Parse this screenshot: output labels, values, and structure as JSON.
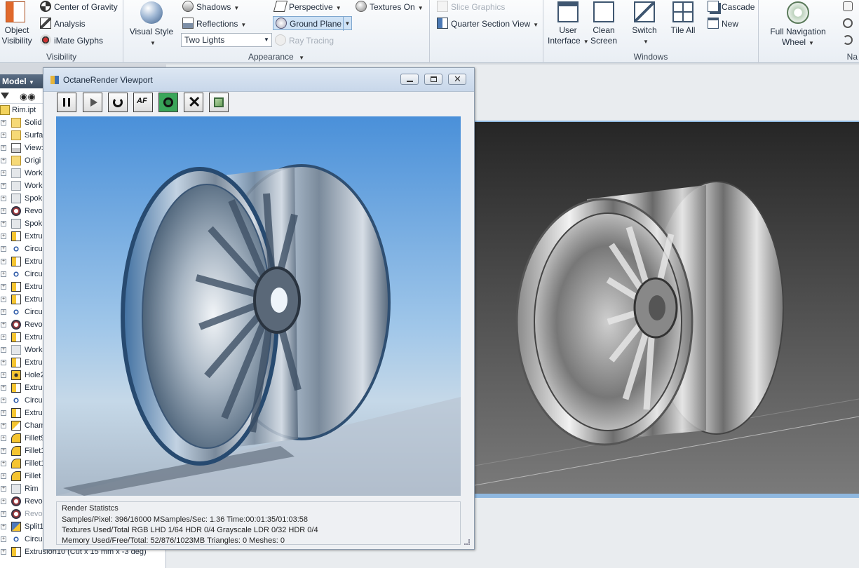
{
  "ribbon": {
    "visibility": {
      "object_visibility_label": "Object\nVisibility",
      "center_of_gravity": "Center of Gravity",
      "analysis": "Analysis",
      "imate_glyphs": "iMate Glyphs",
      "group_label": "Visibility"
    },
    "appearance": {
      "visual_style_label": "Visual Style",
      "shadows": "Shadows",
      "reflections": "Reflections",
      "lights_value": "Two Lights",
      "perspective": "Perspective",
      "ground_plane": "Ground Plane",
      "ray_tracing": "Ray Tracing",
      "textures_on": "Textures On",
      "group_label": "Appearance"
    },
    "section": {
      "slice_graphics": "Slice Graphics",
      "quarter_section_view": "Quarter Section View"
    },
    "windows": {
      "user_interface": "User\nInterface",
      "clean_screen": "Clean\nScreen",
      "switch": "Switch",
      "tile_all": "Tile All",
      "cascade": "Cascade",
      "new": "New",
      "group_label": "Windows"
    },
    "navigate": {
      "full_navigation_wheel": "Full Navigation\nWheel",
      "group_label_partial": "Na"
    }
  },
  "browser": {
    "header": "Model",
    "items": [
      {
        "label": "Rim.ipt",
        "icon": "part-icon",
        "root": true
      },
      {
        "label": "Solid",
        "icon": "folder-icon"
      },
      {
        "label": "Surfa",
        "icon": "folder-icon"
      },
      {
        "label": "View:",
        "icon": "view-icon"
      },
      {
        "label": "Origi",
        "icon": "folder-icon"
      },
      {
        "label": "Work",
        "icon": "workplane-icon"
      },
      {
        "label": "Work",
        "icon": "workplane-icon"
      },
      {
        "label": "Spok",
        "icon": "sketch-icon"
      },
      {
        "label": "Revo",
        "icon": "revolve-icon"
      },
      {
        "label": "Spok",
        "icon": "sketch-icon"
      },
      {
        "label": "Extru",
        "icon": "extrude-icon"
      },
      {
        "label": "Circu",
        "icon": "pattern-icon"
      },
      {
        "label": "Extru",
        "icon": "extrude-icon"
      },
      {
        "label": "Circu",
        "icon": "pattern-icon"
      },
      {
        "label": "Extru",
        "icon": "extrude-icon"
      },
      {
        "label": "Extru",
        "icon": "extrude-icon"
      },
      {
        "label": "Circu",
        "icon": "pattern-icon"
      },
      {
        "label": "Revo",
        "icon": "revolve-icon"
      },
      {
        "label": "Extru",
        "icon": "extrude-icon"
      },
      {
        "label": "Work",
        "icon": "workplane-icon"
      },
      {
        "label": "Extru",
        "icon": "extrude-icon"
      },
      {
        "label": "Hole2",
        "icon": "hole-icon"
      },
      {
        "label": "Extru",
        "icon": "extrude-icon"
      },
      {
        "label": "Circu",
        "icon": "pattern-icon"
      },
      {
        "label": "Extru",
        "icon": "extrude-icon"
      },
      {
        "label": "Cham",
        "icon": "chamfer-icon"
      },
      {
        "label": "Fillet9",
        "icon": "fillet-icon"
      },
      {
        "label": "Fillet1",
        "icon": "fillet-icon"
      },
      {
        "label": "Fillet1",
        "icon": "fillet-icon"
      },
      {
        "label": "Fillet",
        "icon": "fillet-icon"
      },
      {
        "label": "Rim",
        "icon": "sketch-icon"
      },
      {
        "label": "Revo",
        "icon": "revolve-icon"
      },
      {
        "label": "Revo",
        "icon": "revolve-icon",
        "dim": true
      },
      {
        "label": "Split1",
        "icon": "split-icon"
      },
      {
        "label": "Circu",
        "icon": "pattern-icon"
      },
      {
        "label": "Extrusion10 (Cut x 15 mm x -3 deg)",
        "icon": "extrude-icon"
      }
    ]
  },
  "octane": {
    "title": "OctaneRender Viewport",
    "toolbar": [
      "pause-icon",
      "play-icon",
      "restart-icon",
      "focus-picker-icon",
      "material-picker-icon",
      "stop-icon",
      "export-icon"
    ],
    "stats": {
      "heading": "Render Statistcs",
      "line1": "Samples/Pixel:  396/16000   MSamples/Sec:  1.36   Time:00:01:35/01:03:58",
      "line2": "Textures Used/Total RGB LHD 1/64   HDR 0/4   Grayscale LDR 0/32   HDR 0/4",
      "line3": "Memory Used/Free/Total: 52/876/1023MB   Triangles:  0   Meshes:  0"
    }
  },
  "colors": {
    "ribbon_bg": "#eef2f6",
    "ground_plane_highlight": "#cfe2f5",
    "octane_active": "#3aa65a",
    "render_sky": "#4a90d9"
  }
}
